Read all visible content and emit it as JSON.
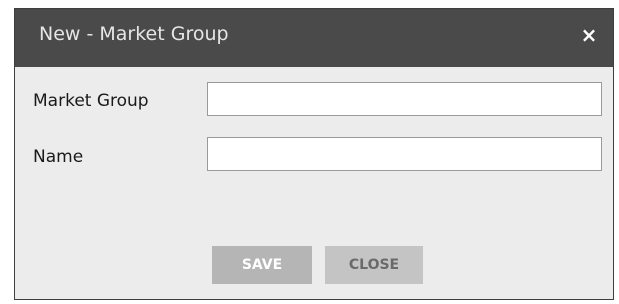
{
  "dialog": {
    "title": "New - Market Group",
    "close_glyph": "×"
  },
  "form": {
    "fields": [
      {
        "label": "Market Group",
        "value": "",
        "placeholder": ""
      },
      {
        "label": "Name",
        "value": "",
        "placeholder": ""
      }
    ]
  },
  "actions": {
    "save_label": "SAVE",
    "close_label": "CLOSE"
  },
  "colors": {
    "titlebar": "#4a4a4a",
    "body": "#ececec",
    "button": "#b5b5b5"
  },
  "icons": {
    "close": "close-icon"
  }
}
